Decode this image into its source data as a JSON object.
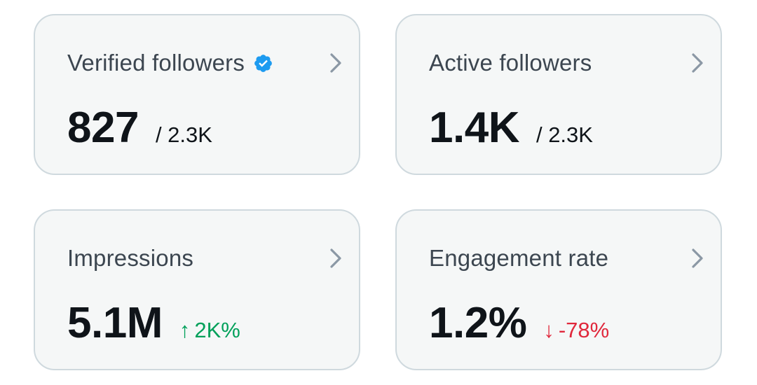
{
  "cards": [
    {
      "title": "Verified followers",
      "verified": true,
      "value": "827",
      "total": "/ 2.3K"
    },
    {
      "title": "Active followers",
      "value": "1.4K",
      "total": "/ 2.3K"
    },
    {
      "title": "Impressions",
      "value": "5.1M",
      "change": {
        "direction": "up",
        "arrow": "↑",
        "text": "2K%"
      }
    },
    {
      "title": "Engagement rate",
      "value": "1.2%",
      "change": {
        "direction": "down",
        "arrow": "↓",
        "text": "-78%"
      }
    }
  ],
  "icons": {
    "verified": "verified-badge-icon",
    "chevron": "chevron-right-icon"
  },
  "colors": {
    "verified_badge": "#1d9bf0",
    "chevron": "#8b98a5",
    "change_up": "#00a05a",
    "change_down": "#e0283c",
    "card_background": "#f5f7f7",
    "card_border": "#cfd9de"
  }
}
